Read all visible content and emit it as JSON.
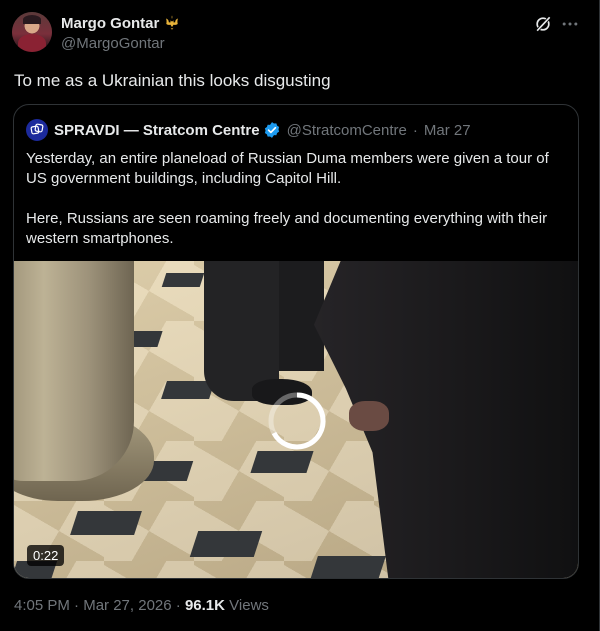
{
  "author": {
    "display_name": "Margo Gontar",
    "handle": "@MargoGontar"
  },
  "tweet": {
    "text": "To me as a Ukrainian this looks disgusting"
  },
  "quote": {
    "display_name": "SPRAVDI — Stratcom Centre",
    "handle": "@StratcomCentre",
    "separator": "·",
    "date": "Mar 27",
    "text": "Yesterday, an entire planeload of Russian Duma members were given a tour of US government buildings, including Capitol Hill.\n\nHere, Russians are seen roaming freely and documenting everything with their western smartphones.",
    "video_duration": "0:22"
  },
  "meta": {
    "time": "4:05 PM",
    "dot1": "·",
    "date": "Mar 27, 2026",
    "dot2": "·",
    "views_count": "96.1K",
    "views_label": "Views"
  },
  "icons": {
    "crest": "ukraine-trident-icon",
    "grok": "grok-icon",
    "more": "more-icon",
    "verified": "verified-badge-icon"
  },
  "colors": {
    "background": "#000000",
    "text": "#e7e9ea",
    "muted": "#71767b",
    "border": "#2f3336",
    "verified_blue": "#1d9bf0",
    "crest_gold": "#e8b33a"
  }
}
